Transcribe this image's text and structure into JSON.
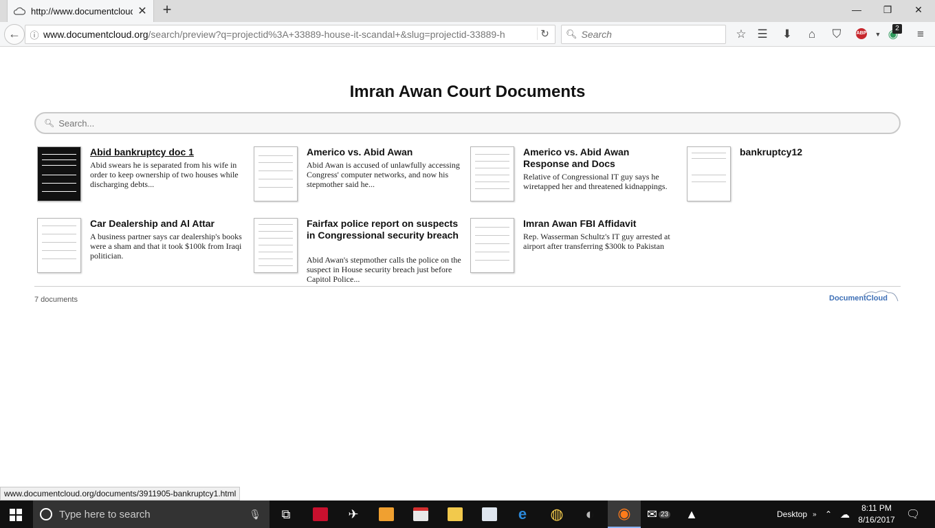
{
  "browser": {
    "tab_title": "http://www.documentcloud.o",
    "new_tab": "+",
    "url_domain": "www.documentcloud.org",
    "url_path": "/search/preview?q=projectid%3A+33889-house-it-scandal+&slug=projectid-33889-h",
    "search_placeholder": "Search",
    "abp_label": "ABP",
    "extension_badge": "2",
    "status_url": "www.documentcloud.org/documents/3911905-bankruptcy1.html"
  },
  "page": {
    "title": "Imran Awan Court Documents",
    "search_placeholder": "Search...",
    "count": "7 documents",
    "logo": "DocumentCloud"
  },
  "documents": [
    {
      "title": "Abid bankruptcy doc 1",
      "description": "Abid swears he is separated from his wife in order to keep ownership of two houses while discharging debts..."
    },
    {
      "title": "Americo vs. Abid Awan",
      "description": "Abid Awan is accused of unlawfully accessing Congress' computer networks, and now his stepmother said he..."
    },
    {
      "title": "Americo vs. Abid Awan Response and Docs",
      "description": "Relative of Congressional IT guy says he wiretapped her and threatened kidnappings."
    },
    {
      "title": "bankruptcy12",
      "description": ""
    },
    {
      "title": "Car Dealership and Al Attar",
      "description": "A business partner says car dealership's books were a sham and that it took $100k from Iraqi politician."
    },
    {
      "title": "Fairfax police report on suspects in Congressional security breach",
      "description": "Abid Awan's stepmother calls the police on the suspect in House security breach just before Capitol Police..."
    },
    {
      "title": "Imran Awan FBI Affidavit",
      "description": "Rep. Wasserman Schultz's IT guy arrested at airport after transferring $300k to Pakistan"
    }
  ],
  "taskbar": {
    "search_placeholder": "Type here to search",
    "desktop_label": "Desktop",
    "mail_badge": "23",
    "time": "8:11 PM",
    "date": "8/16/2017"
  }
}
